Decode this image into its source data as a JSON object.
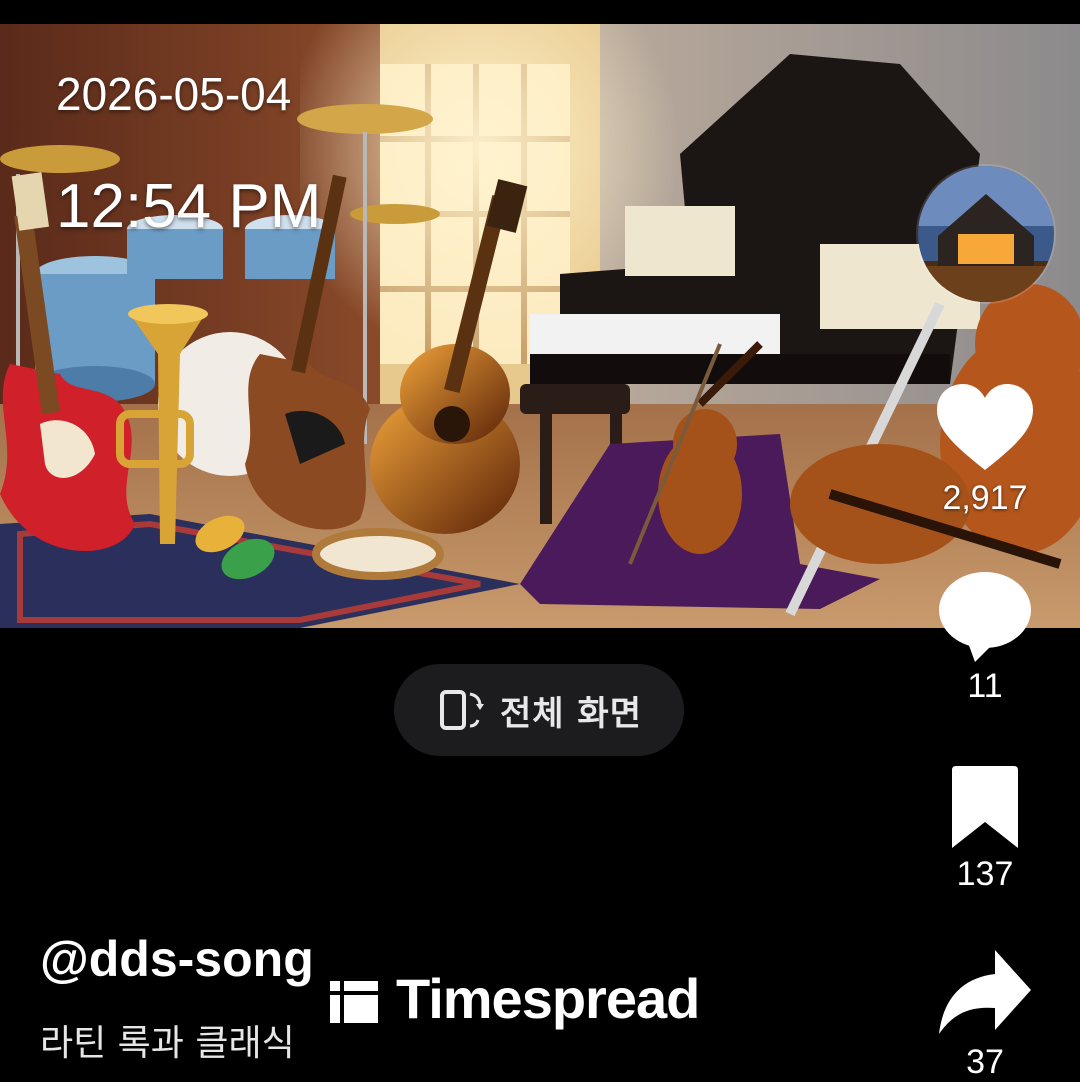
{
  "overlay": {
    "date": "2026-05-04",
    "time": "12:54 PM"
  },
  "actions": {
    "likes": "2,917",
    "comments": "11",
    "bookmarks": "137",
    "shares": "37"
  },
  "fullscreen_button": {
    "label": "전체 화면",
    "icon": "rotate-screen-icon"
  },
  "post": {
    "username": "@dds-song",
    "caption": "라틴 록과 클래식"
  },
  "watermark": {
    "text": "Timespread"
  },
  "icons": [
    "heart-icon",
    "comment-icon",
    "bookmark-icon",
    "share-icon",
    "avatar"
  ],
  "colors": {
    "background": "#000000",
    "pill": "#1c1c1e",
    "text": "#ffffff"
  }
}
